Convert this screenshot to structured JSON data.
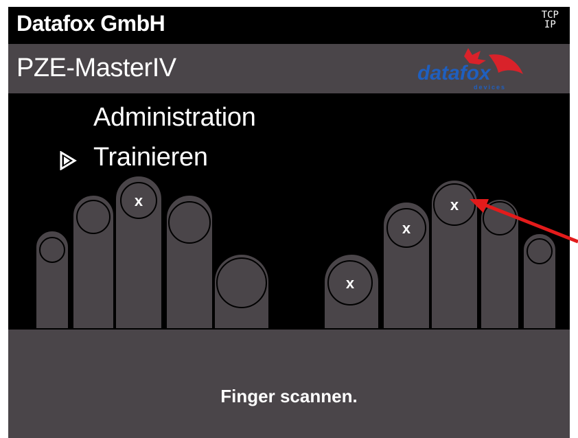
{
  "header": {
    "company": "Datafox GmbH",
    "conn_top": "TCP",
    "conn_bottom": "IP"
  },
  "titlebar": {
    "device": "PZE-MasterIV",
    "logo_text": "datafox",
    "logo_sub": "devices"
  },
  "menu": {
    "items": [
      {
        "label": "Administration",
        "selected": false
      },
      {
        "label": "Trainieren",
        "selected": true
      }
    ]
  },
  "hands": {
    "left": {
      "fingers": [
        {
          "name": "little",
          "marked": false
        },
        {
          "name": "ring",
          "marked": false
        },
        {
          "name": "middle",
          "marked": true,
          "mark": "x"
        },
        {
          "name": "index",
          "marked": false
        },
        {
          "name": "thumb",
          "marked": false
        }
      ]
    },
    "right": {
      "fingers": [
        {
          "name": "thumb",
          "marked": true,
          "mark": "x"
        },
        {
          "name": "index",
          "marked": true,
          "mark": "x"
        },
        {
          "name": "middle",
          "marked": true,
          "mark": "x"
        },
        {
          "name": "ring",
          "marked": false
        },
        {
          "name": "little",
          "marked": false
        }
      ]
    }
  },
  "status": {
    "message": "Finger scannen."
  },
  "colors": {
    "panel": "#4a4549",
    "finger": "#4a4549",
    "annotation_arrow": "#e31b1b",
    "logo_red": "#d9222a"
  }
}
